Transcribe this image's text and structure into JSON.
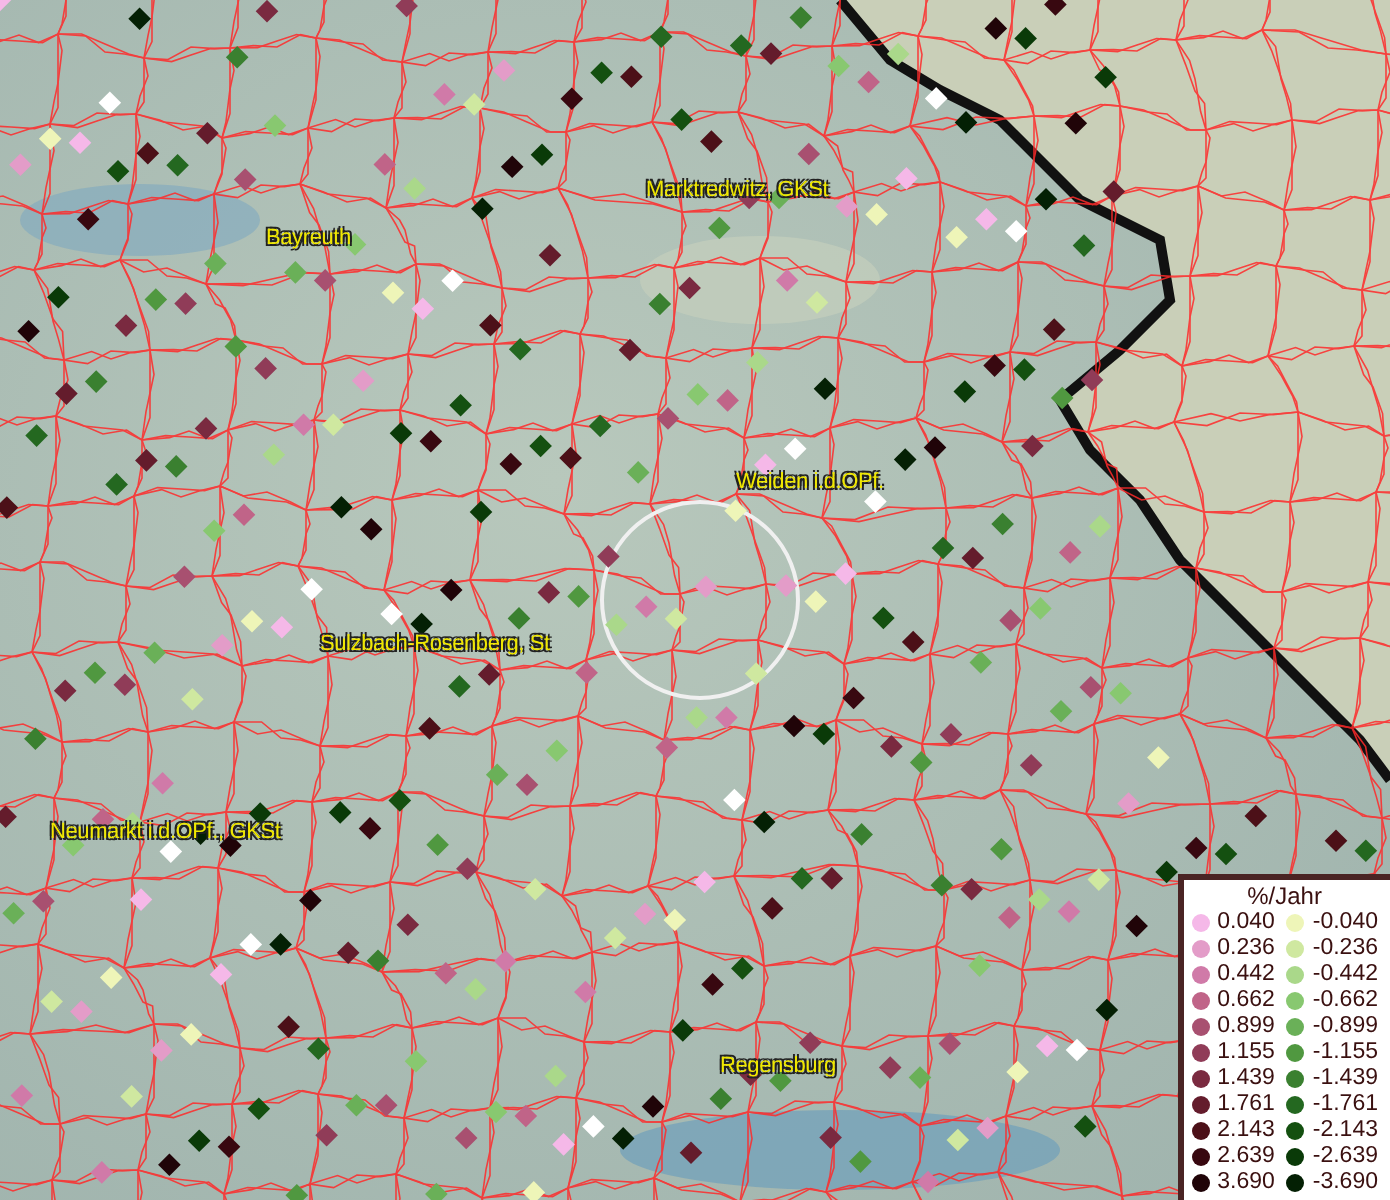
{
  "map": {
    "place_labels": [
      {
        "text": "Marktredwitz, GKSt"
      },
      {
        "text": "Bayreuth"
      },
      {
        "text": "Weiden i.d.OPf."
      },
      {
        "text": "Sulzbach-Rosenberg, St"
      },
      {
        "text": "Neumarkt i.d.OPf., GKSt"
      },
      {
        "text": "Regensburg"
      }
    ]
  },
  "legend": {
    "title": "%/Jahr",
    "entries": [
      {
        "value": "0.040",
        "color": "#f5b8e8"
      },
      {
        "value": "-0.040",
        "color": "#eef5b8"
      },
      {
        "value": "0.236",
        "color": "#e39cc8"
      },
      {
        "value": "-0.236",
        "color": "#cfe8a0"
      },
      {
        "value": "0.442",
        "color": "#d07aa8"
      },
      {
        "value": "-0.442",
        "color": "#aad88a"
      },
      {
        "value": "0.662",
        "color": "#c06488"
      },
      {
        "value": "-0.662",
        "color": "#88c870"
      },
      {
        "value": "0.899",
        "color": "#a85070"
      },
      {
        "value": "-0.899",
        "color": "#6ab058"
      },
      {
        "value": "1.155",
        "color": "#903c58"
      },
      {
        "value": "-1.155",
        "color": "#509840"
      },
      {
        "value": "1.439",
        "color": "#7a2a40"
      },
      {
        "value": "-1.439",
        "color": "#3a8030"
      },
      {
        "value": "1.761",
        "color": "#641c2c"
      },
      {
        "value": "-1.761",
        "color": "#246820"
      },
      {
        "value": "2.143",
        "color": "#4c1018"
      },
      {
        "value": "-2.143",
        "color": "#145010"
      },
      {
        "value": "2.639",
        "color": "#380810"
      },
      {
        "value": "-2.639",
        "color": "#0a3a08"
      },
      {
        "value": "3.690",
        "color": "#200408"
      },
      {
        "value": "-3.690",
        "color": "#042004"
      }
    ]
  }
}
